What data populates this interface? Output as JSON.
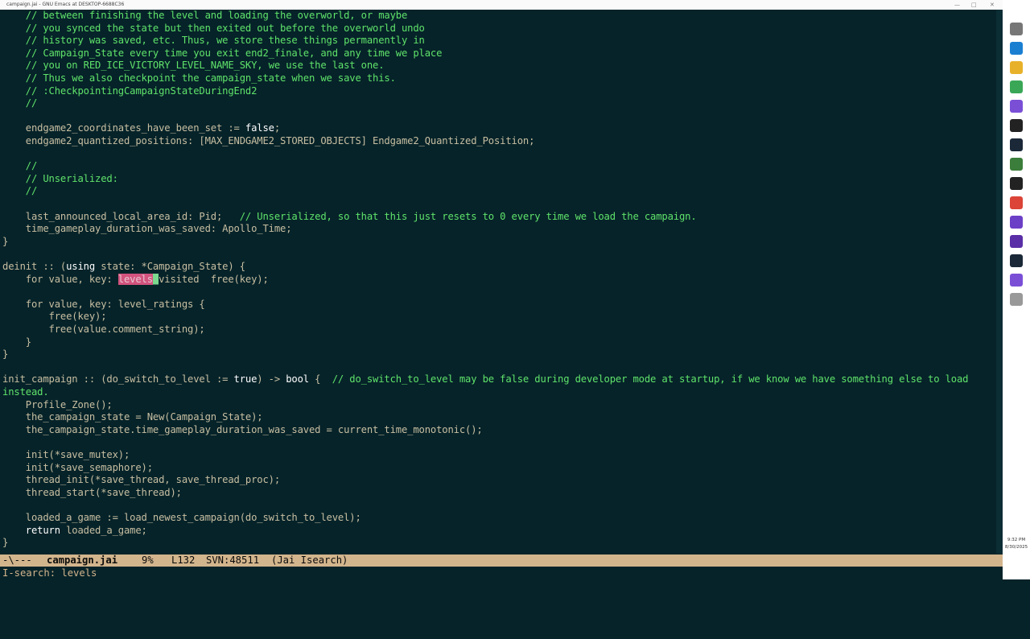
{
  "window": {
    "title": "campaign.jai - GNU Emacs at DESKTOP-6688C36"
  },
  "colors": {
    "background": "#062329",
    "code": "#c8bfa2",
    "comment": "#5fe36a",
    "keyword": "#ffffff",
    "search_highlight": "#d2537e",
    "modeline_bg": "#d3b58d"
  },
  "code_lines": [
    [
      {
        "c": "    // between finishing the level and loading the overworld, or maybe",
        "t": "cm"
      }
    ],
    [
      {
        "c": "    // you synced the state but then exited out before the overworld undo",
        "t": "cm"
      }
    ],
    [
      {
        "c": "    // history was saved, etc. Thus, we store these things permanently in",
        "t": "cm"
      }
    ],
    [
      {
        "c": "    // Campaign_State every time you exit end2_finale, and any time we place",
        "t": "cm"
      }
    ],
    [
      {
        "c": "    // you on RED_ICE_VICTORY_LEVEL_NAME_SKY, we use the last one.",
        "t": "cm"
      }
    ],
    [
      {
        "c": "    // Thus we also checkpoint the campaign_state when we save this.",
        "t": "cm"
      }
    ],
    [
      {
        "c": "    // :CheckpointingCampaignStateDuringEnd2",
        "t": "cm"
      }
    ],
    [
      {
        "c": "    //",
        "t": "cm"
      }
    ],
    [],
    [
      {
        "c": "    endgame2_coordinates_have_been_set := ",
        "t": ""
      },
      {
        "c": "false",
        "t": "kw"
      },
      {
        "c": ";",
        "t": ""
      }
    ],
    [
      {
        "c": "    endgame2_quantized_positions: [MAX_ENDGAME2_STORED_OBJECTS] Endgame2_Quantized_Position;",
        "t": ""
      }
    ],
    [],
    [
      {
        "c": "    //",
        "t": "cm"
      }
    ],
    [
      {
        "c": "    // Unserialized:",
        "t": "cm"
      }
    ],
    [
      {
        "c": "    //",
        "t": "cm"
      }
    ],
    [],
    [
      {
        "c": "    last_announced_local_area_id: Pid;   ",
        "t": ""
      },
      {
        "c": "// Unserialized, so that this just resets to 0 every time we load the campaign.",
        "t": "cm"
      }
    ],
    [
      {
        "c": "    time_gameplay_duration_was_saved: Apollo_Time;",
        "t": ""
      }
    ],
    [
      {
        "c": "}",
        "t": ""
      }
    ],
    [],
    [
      {
        "c": "deinit :: (",
        "t": ""
      },
      {
        "c": "using",
        "t": "kw"
      },
      {
        "c": " state: *Campaign_State) {",
        "t": ""
      }
    ],
    [
      {
        "c": "    for value, key: ",
        "t": ""
      },
      {
        "c": "levels",
        "t": "hl"
      },
      {
        "c": "_",
        "t": "cur"
      },
      {
        "c": "visited  free(key);",
        "t": ""
      }
    ],
    [],
    [
      {
        "c": "    for value, key: level_ratings {",
        "t": ""
      }
    ],
    [
      {
        "c": "        free(key);",
        "t": ""
      }
    ],
    [
      {
        "c": "        free(value.comment_string);",
        "t": ""
      }
    ],
    [
      {
        "c": "    }",
        "t": ""
      }
    ],
    [
      {
        "c": "}",
        "t": ""
      }
    ],
    [],
    [
      {
        "c": "init_campaign :: (do_switch_to_level := ",
        "t": ""
      },
      {
        "c": "true",
        "t": "kw"
      },
      {
        "c": ") -> ",
        "t": ""
      },
      {
        "c": "bool",
        "t": "kw"
      },
      {
        "c": " {  ",
        "t": ""
      },
      {
        "c": "// do_switch_to_level may be false during developer mode at startup, if we know we have something else to load",
        "t": "cm"
      }
    ],
    [
      {
        "c": "instead.",
        "t": "cm"
      }
    ],
    [
      {
        "c": "    Profile_Zone();",
        "t": ""
      }
    ],
    [
      {
        "c": "    the_campaign_state = New(Campaign_State);",
        "t": ""
      }
    ],
    [
      {
        "c": "    the_campaign_state.time_gameplay_duration_was_saved = current_time_monotonic();",
        "t": ""
      }
    ],
    [],
    [
      {
        "c": "    init(*save_mutex);",
        "t": ""
      }
    ],
    [
      {
        "c": "    init(*save_semaphore);",
        "t": ""
      }
    ],
    [
      {
        "c": "    thread_init(*save_thread, save_thread_proc);",
        "t": ""
      }
    ],
    [
      {
        "c": "    thread_start(*save_thread);",
        "t": ""
      }
    ],
    [],
    [
      {
        "c": "    loaded_a_game := load_newest_campaign(do_switch_to_level);",
        "t": ""
      }
    ],
    [
      {
        "c": "    return",
        "t": "kw"
      },
      {
        "c": " loaded_a_game;",
        "t": ""
      }
    ],
    [
      {
        "c": "}",
        "t": ""
      }
    ]
  ],
  "modeline": {
    "status": "-\\---",
    "buffer": "campaign.jai",
    "percent": "9%",
    "line": "L132",
    "svn": "SVN:48511",
    "modes": "(Jai Isearch)"
  },
  "minibuffer": {
    "text": "I-search: levels"
  },
  "taskbar": {
    "icons": [
      "window-icon",
      "visual-studio-icon",
      "file-explorer-icon",
      "chrome-icon",
      "emacs-icon",
      "terminal-icon",
      "steam-icon",
      "obs-icon",
      "terminal-icon-2",
      "chrome-icon-2",
      "visual-studio-icon-2",
      "visual-studio-icon-3",
      "steam-icon-2",
      "emacs-icon-2",
      "shield-icon"
    ],
    "time": "9:32 PM",
    "date": "8/30/2025"
  }
}
